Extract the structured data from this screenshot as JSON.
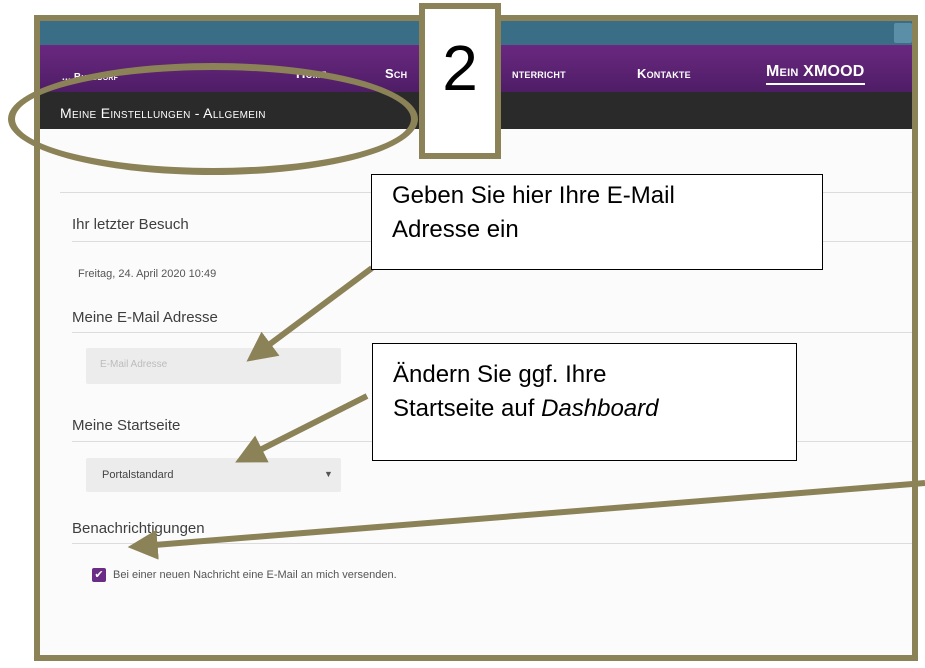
{
  "nav": {
    "brand": "... Burgdorf",
    "items": [
      "Home",
      "Sch",
      "nterricht",
      "Kontakte",
      "Mein XMOOD"
    ]
  },
  "page_title": "Meine Einstellungen - Allgemein",
  "sections": {
    "last_visit": {
      "label": "Ihr letzter Besuch",
      "value": "Freitag, 24. April 2020 10:49"
    },
    "email": {
      "label": "Meine E-Mail Adresse",
      "placeholder": "E-Mail Adresse"
    },
    "startpage": {
      "label": "Meine Startseite",
      "selected": "Portalstandard"
    },
    "notifications": {
      "label": "Benachrichtigungen",
      "checkbox_label": "Bei einer neuen Nachricht eine E-Mail an mich versenden.",
      "checked": true
    }
  },
  "annotation": {
    "step_number": "2",
    "callout1_line1": "Geben Sie hier Ihre E-Mail",
    "callout1_line2": "Adresse ein",
    "callout2_line1": "Ändern Sie ggf. Ihre",
    "callout2_line2": "Startseite auf ",
    "callout2_emph": "Dashboard",
    "color": "#8b8258"
  }
}
